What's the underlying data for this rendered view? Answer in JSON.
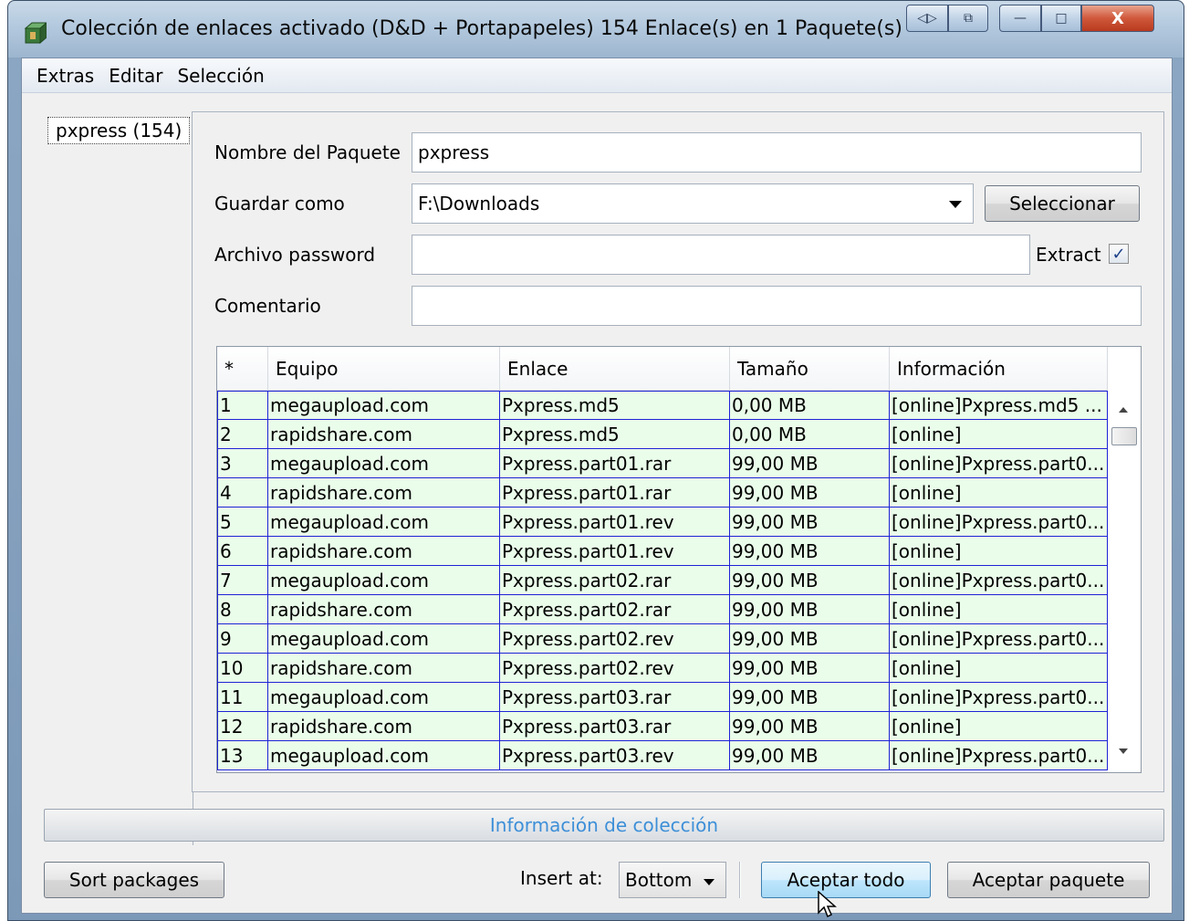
{
  "window": {
    "title": "Colección de enlaces activado (D&D + Portapapeles) 154 Enlace(s) en 1 Paquete(s)",
    "controls": {
      "prev_next": "◁▷",
      "restore_icon": "⧉",
      "minimize": "—",
      "maximize": "□",
      "close": "X"
    }
  },
  "menu": [
    "Extras",
    "Editar",
    "Selección"
  ],
  "packages": [
    {
      "label": "pxpress (154)"
    }
  ],
  "form": {
    "package_name_label": "Nombre del Paquete",
    "package_name_value": "pxpress",
    "save_as_label": "Guardar como",
    "save_as_value": "F:\\Downloads",
    "select_button": "Seleccionar",
    "password_label": "Archivo password",
    "password_value": "",
    "extract_label": "Extract",
    "extract_checked": true,
    "comment_label": "Comentario",
    "comment_value": ""
  },
  "table": {
    "columns": [
      "*",
      "Equipo",
      "Enlace",
      "Tamaño",
      "Información"
    ],
    "rows": [
      [
        "1",
        "megaupload.com",
        "Pxpress.md5",
        "0,00 MB",
        "[online]Pxpress.md5 ..."
      ],
      [
        "2",
        "rapidshare.com",
        "Pxpress.md5",
        "0,00 MB",
        "[online]"
      ],
      [
        "3",
        "megaupload.com",
        "Pxpress.part01.rar",
        "99,00 MB",
        "[online]Pxpress.part0..."
      ],
      [
        "4",
        "rapidshare.com",
        "Pxpress.part01.rar",
        "99,00 MB",
        "[online]"
      ],
      [
        "5",
        "megaupload.com",
        "Pxpress.part01.rev",
        "99,00 MB",
        "[online]Pxpress.part0..."
      ],
      [
        "6",
        "rapidshare.com",
        "Pxpress.part01.rev",
        "99,00 MB",
        "[online]"
      ],
      [
        "7",
        "megaupload.com",
        "Pxpress.part02.rar",
        "99,00 MB",
        "[online]Pxpress.part0..."
      ],
      [
        "8",
        "rapidshare.com",
        "Pxpress.part02.rar",
        "99,00 MB",
        "[online]"
      ],
      [
        "9",
        "megaupload.com",
        "Pxpress.part02.rev",
        "99,00 MB",
        "[online]Pxpress.part0..."
      ],
      [
        "10",
        "rapidshare.com",
        "Pxpress.part02.rev",
        "99,00 MB",
        "[online]"
      ],
      [
        "11",
        "megaupload.com",
        "Pxpress.part03.rar",
        "99,00 MB",
        "[online]Pxpress.part0..."
      ],
      [
        "12",
        "rapidshare.com",
        "Pxpress.part03.rar",
        "99,00 MB",
        "[online]"
      ],
      [
        "13",
        "megaupload.com",
        "Pxpress.part03.rev",
        "99,00 MB",
        "[online]Pxpress.part0..."
      ]
    ]
  },
  "collection_info": "Información de colección",
  "bottom": {
    "sort_packages": "Sort packages",
    "insert_at_label": "Insert at:",
    "insert_at_value": "Bottom",
    "accept_all": "Aceptar todo",
    "accept_package": "Aceptar paquete"
  },
  "colors": {
    "row_bg": "#eafdea",
    "row_border": "#1e22d6",
    "info_text": "#3d8fd8"
  }
}
